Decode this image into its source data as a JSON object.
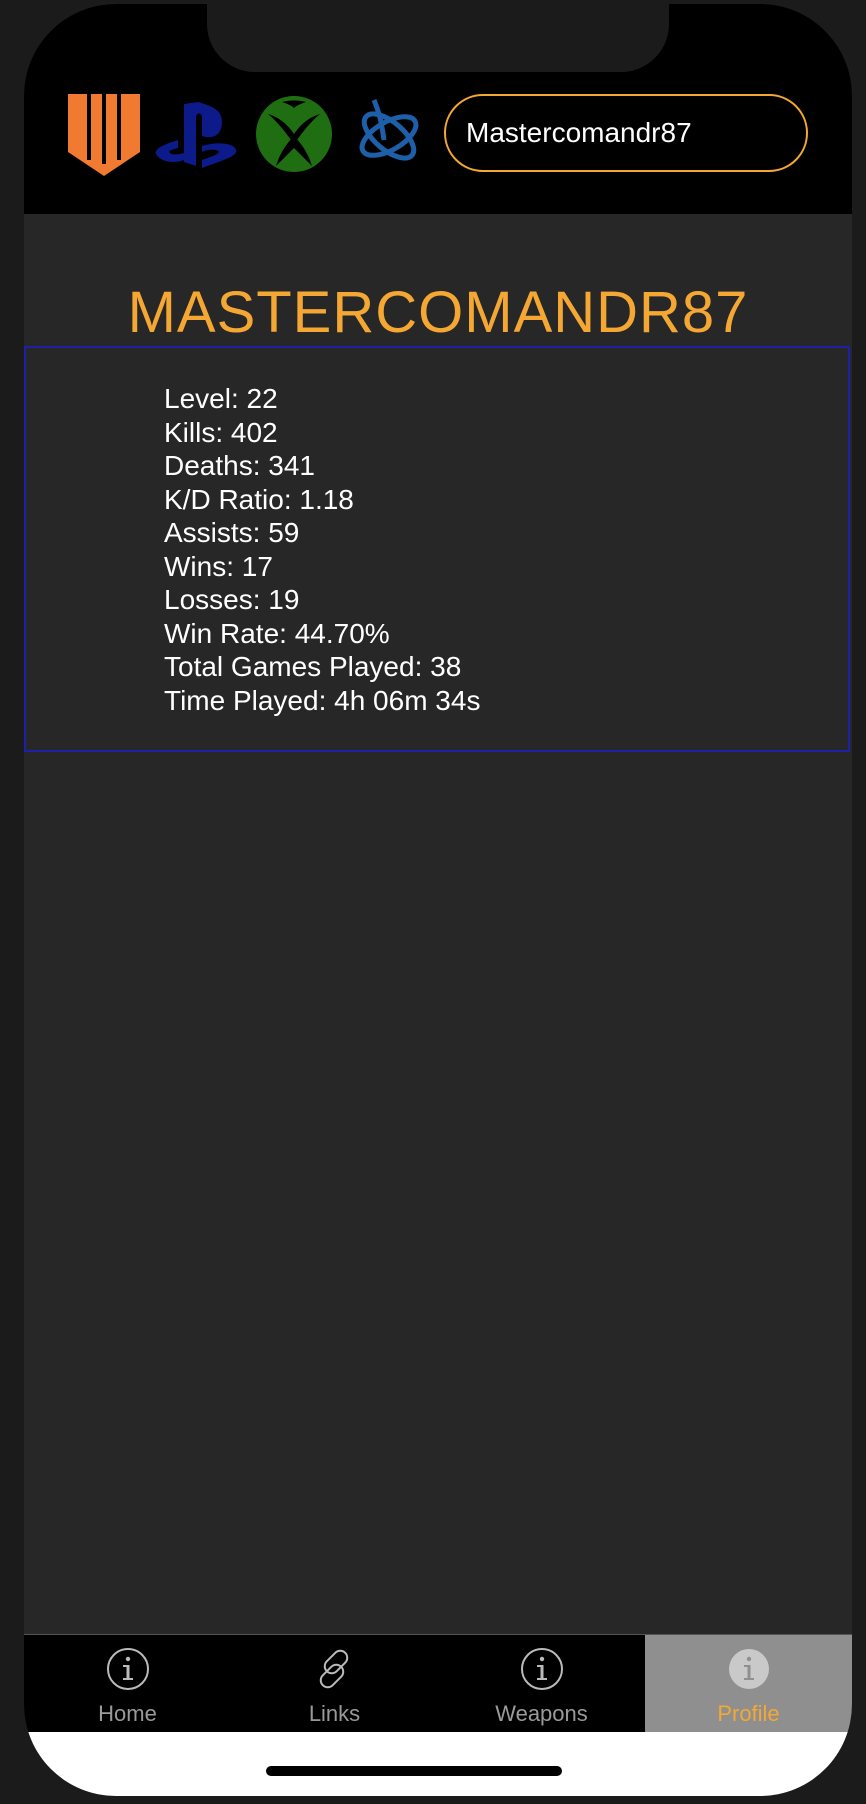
{
  "header": {
    "logos": [
      {
        "name": "black-ops-4-logo",
        "color": "#f07a30"
      },
      {
        "name": "playstation-logo",
        "color": "#0c1a8a"
      },
      {
        "name": "xbox-logo",
        "color": "#1f6f12"
      },
      {
        "name": "battle-net-logo",
        "color": "#1d5fa8"
      }
    ],
    "search_value": "Mastercomandr87"
  },
  "profile": {
    "title": "MASTERCOMANDR87",
    "stats": [
      "Level: 22",
      "Kills: 402",
      "Deaths: 341",
      "K/D Ratio: 1.18",
      "Assists: 59",
      "Wins: 17",
      "Losses: 19",
      "Win Rate: 44.70%",
      "Total Games Played: 38",
      "Time Played: 4h 06m 34s"
    ]
  },
  "tabs": [
    {
      "label": "Home",
      "icon": "info-icon",
      "active": false
    },
    {
      "label": "Links",
      "icon": "link-icon",
      "active": false
    },
    {
      "label": "Weapons",
      "icon": "info-icon",
      "active": false
    },
    {
      "label": "Profile",
      "icon": "info-icon",
      "active": true
    }
  ],
  "colors": {
    "accent": "#f4a733",
    "background": "#272727",
    "stats_border": "#1f1fa8"
  }
}
